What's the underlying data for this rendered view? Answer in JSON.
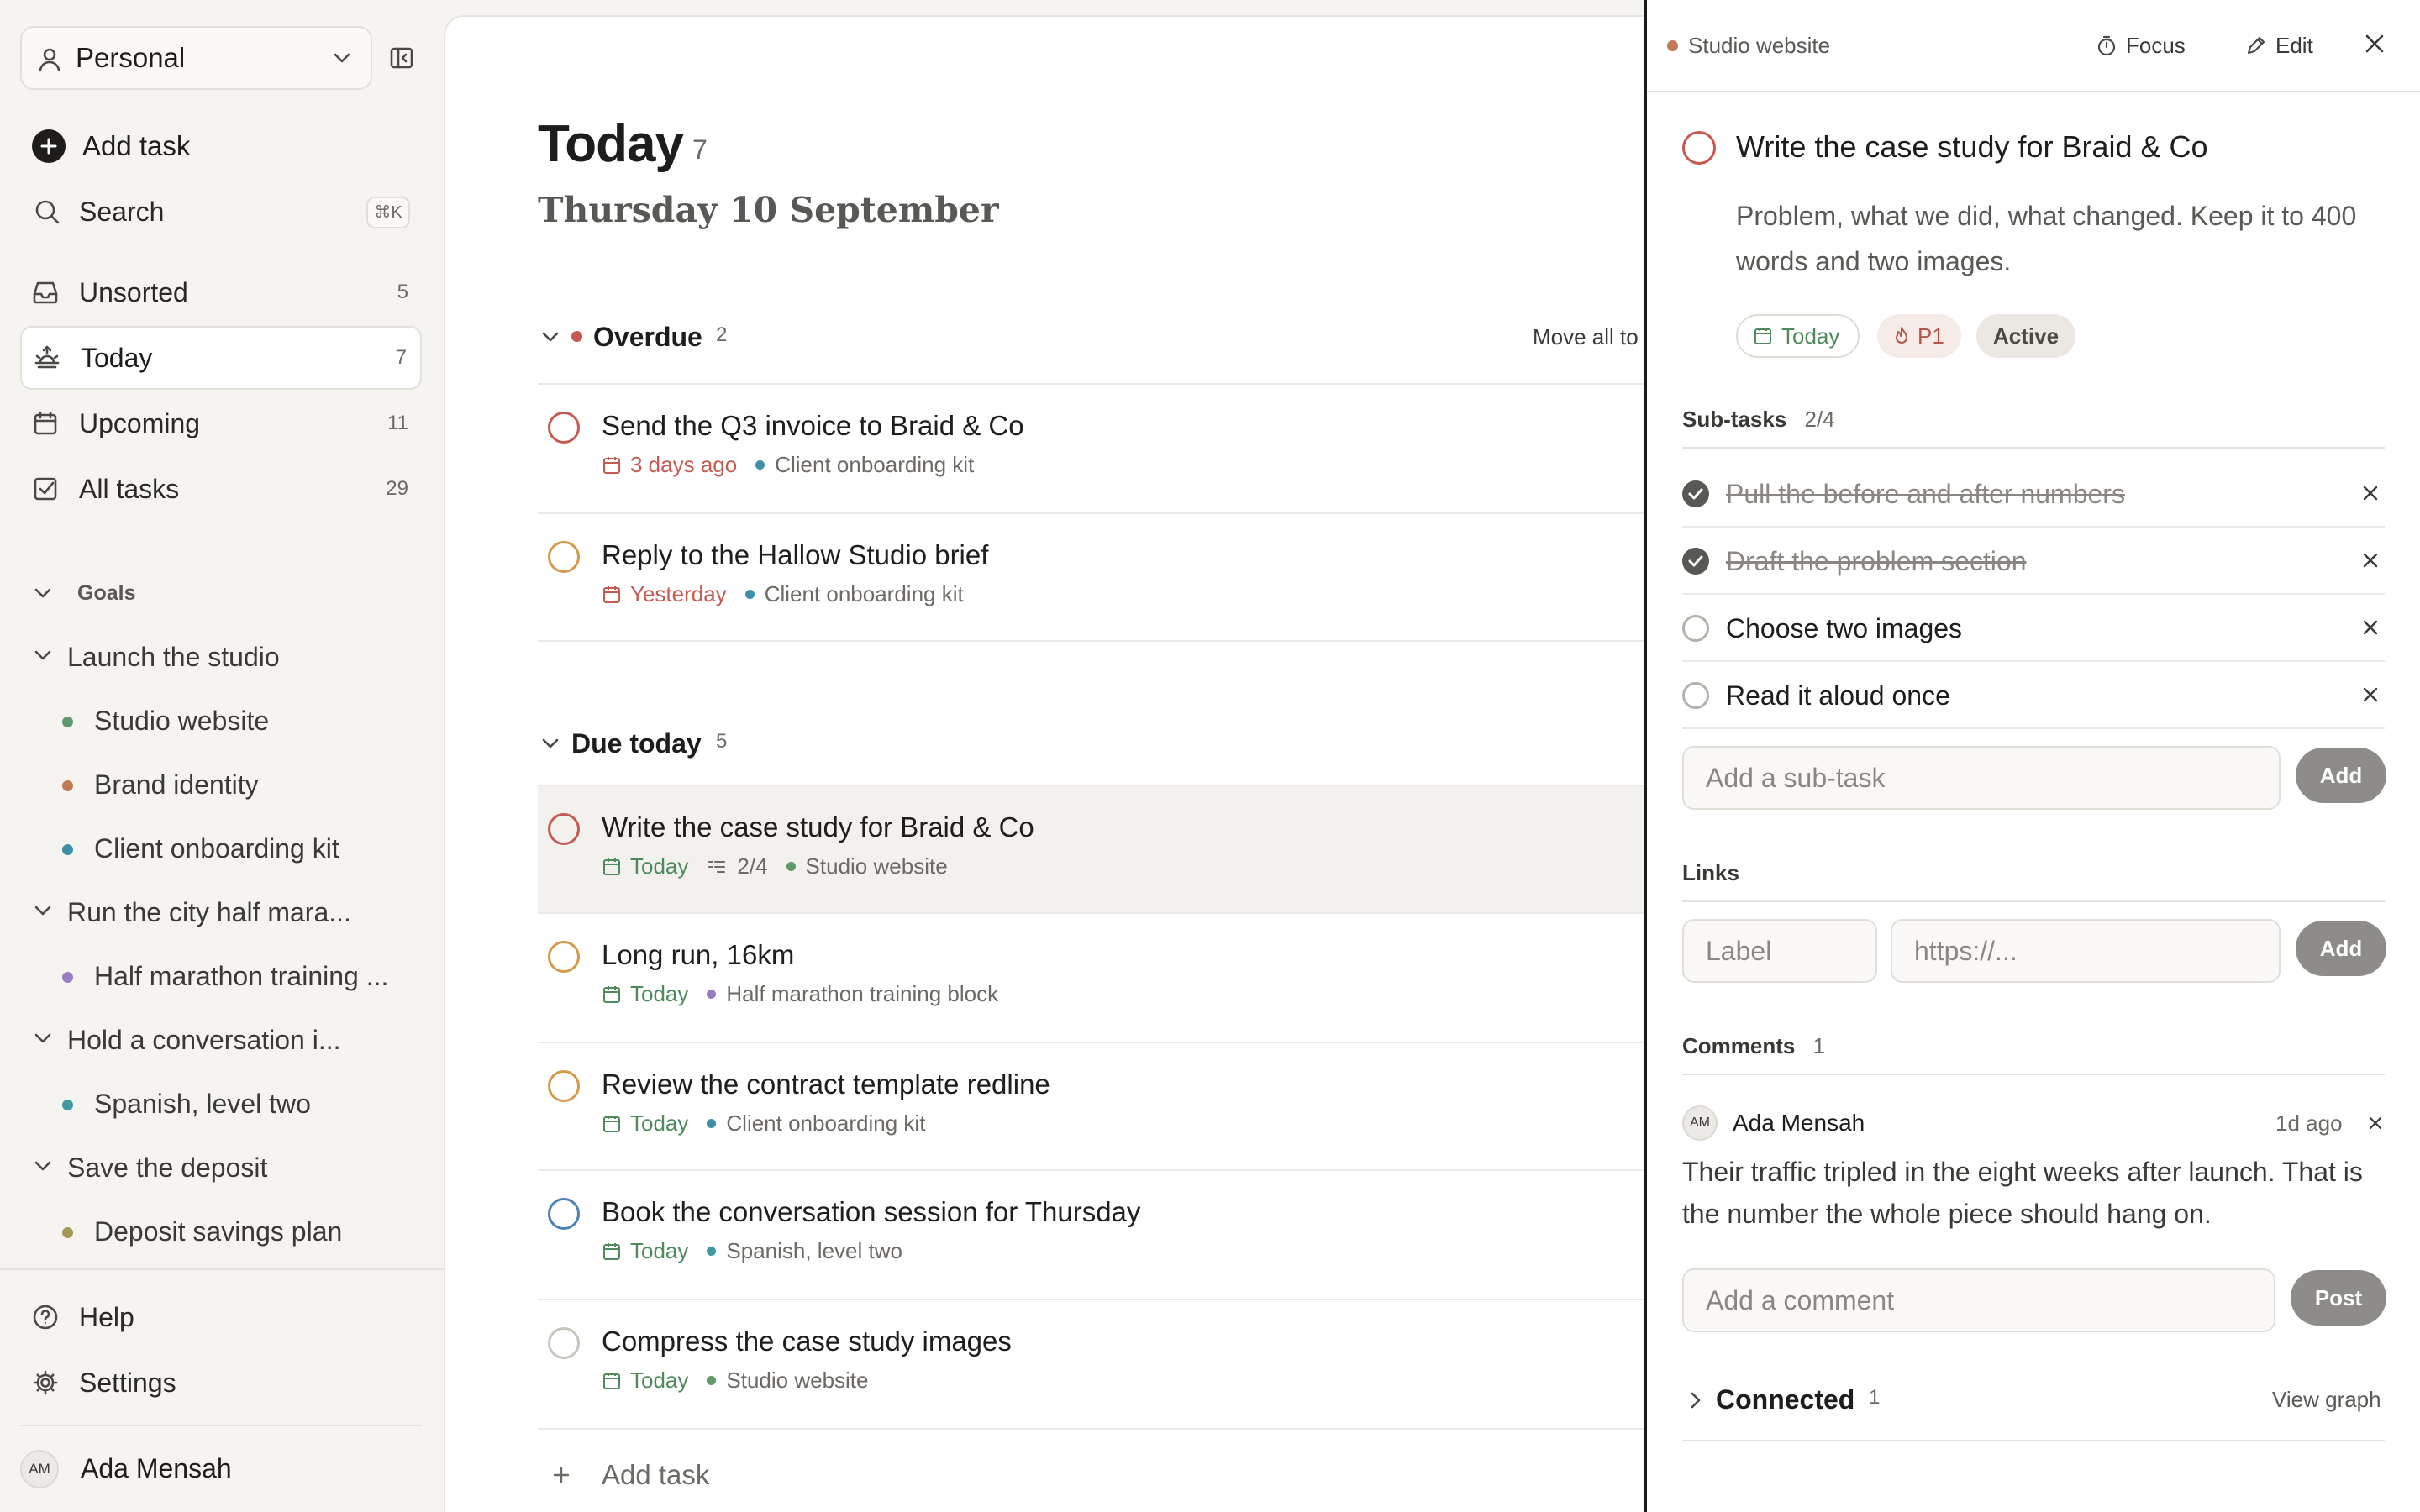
{
  "sidebar": {
    "workspace": "Personal",
    "add_task": "Add task",
    "search": "Search",
    "search_shortcut": "⌘K",
    "nav": [
      {
        "label": "Unsorted",
        "count": "5",
        "icon": "inbox-icon"
      },
      {
        "label": "Today",
        "count": "7",
        "icon": "sunrise-icon"
      },
      {
        "label": "Upcoming",
        "count": "11",
        "icon": "calendar-icon"
      },
      {
        "label": "All tasks",
        "count": "29",
        "icon": "checkbox-icon"
      }
    ],
    "goals_label": "Goals",
    "goals": [
      {
        "title": "Launch the studio",
        "projects": [
          {
            "name": "Studio website",
            "color": "#5f9a6a"
          },
          {
            "name": "Brand identity",
            "color": "#c07a55"
          },
          {
            "name": "Client onboarding kit",
            "color": "#3d8fa9"
          }
        ]
      },
      {
        "title": "Run the city half mara...",
        "projects": [
          {
            "name": "Half marathon training ...",
            "color": "#9a7cc0"
          }
        ]
      },
      {
        "title": "Hold a conversation i...",
        "projects": [
          {
            "name": "Spanish, level two",
            "color": "#3d9aa0"
          }
        ]
      },
      {
        "title": "Save the deposit",
        "projects": [
          {
            "name": "Deposit savings plan",
            "color": "#a49a55"
          }
        ]
      }
    ],
    "help": "Help",
    "settings": "Settings",
    "user": {
      "initials": "AM",
      "name": "Ada Mensah"
    }
  },
  "main": {
    "title": "Today",
    "title_count": "7",
    "date": "Thursday 10 September",
    "overdue": {
      "label": "Overdue",
      "count": "2",
      "move_all": "Move all to",
      "tasks": [
        {
          "title": "Send the Q3 invoice to Braid & Co",
          "due": "3 days ago",
          "project": "Client onboarding kit",
          "project_color": "#3d8fa9",
          "priority_color": "#c65a52"
        },
        {
          "title": "Reply to the Hallow Studio brief",
          "due": "Yesterday",
          "project": "Client onboarding kit",
          "project_color": "#3d8fa9",
          "priority_color": "#d49a4a"
        }
      ]
    },
    "due_today": {
      "label": "Due today",
      "count": "5",
      "tasks": [
        {
          "title": "Write the case study for Braid & Co",
          "due": "Today",
          "subtasks": "2/4",
          "project": "Studio website",
          "project_color": "#5f9a6a",
          "priority_color": "#c65a52"
        },
        {
          "title": "Long run, 16km",
          "due": "Today",
          "project": "Half marathon training block",
          "project_color": "#9a7cc0",
          "priority_color": "#d49a4a"
        },
        {
          "title": "Review the contract template redline",
          "due": "Today",
          "project": "Client onboarding kit",
          "project_color": "#3d8fa9",
          "priority_color": "#d49a4a"
        },
        {
          "title": "Book the conversation session for Thursday",
          "due": "Today",
          "project": "Spanish, level two",
          "project_color": "#3d9aa0",
          "priority_color": "#4d82b8"
        },
        {
          "title": "Compress the case study images",
          "due": "Today",
          "project": "Studio website",
          "project_color": "#5f9a6a",
          "priority_color": "#c8c4be"
        }
      ]
    },
    "add_task": "Add task"
  },
  "detail": {
    "project": "Studio website",
    "project_color": "#c07a55",
    "focus": "Focus",
    "edit": "Edit",
    "title": "Write the case study for Braid & Co",
    "description": "Problem, what we did, what changed. Keep it to 400 words and two images.",
    "chips": {
      "due": "Today",
      "priority": "P1",
      "status": "Active"
    },
    "subtasks_label": "Sub-tasks",
    "subtasks_count": "2/4",
    "subtasks": [
      {
        "title": "Pull the before and after numbers",
        "done": true
      },
      {
        "title": "Draft the problem section",
        "done": true
      },
      {
        "title": "Choose two images",
        "done": false
      },
      {
        "title": "Read it aloud once",
        "done": false
      }
    ],
    "subtask_placeholder": "Add a sub-task",
    "add_label": "Add",
    "links_label": "Links",
    "link_label_placeholder": "Label",
    "link_url_placeholder": "https://...",
    "comments_label": "Comments",
    "comments_count": "1",
    "comment": {
      "initials": "AM",
      "author": "Ada Mensah",
      "time": "1d ago",
      "text": "Their traffic tripled in the eight weeks after launch. That is the number the whole piece should hang on."
    },
    "comment_placeholder": "Add a comment",
    "post_label": "Post",
    "connected_label": "Connected",
    "connected_count": "1",
    "view_graph": "View graph"
  },
  "colors": {
    "overdue_red": "#c65a52",
    "today_green": "#4f8a5c",
    "accent": "#1a1a1a"
  }
}
